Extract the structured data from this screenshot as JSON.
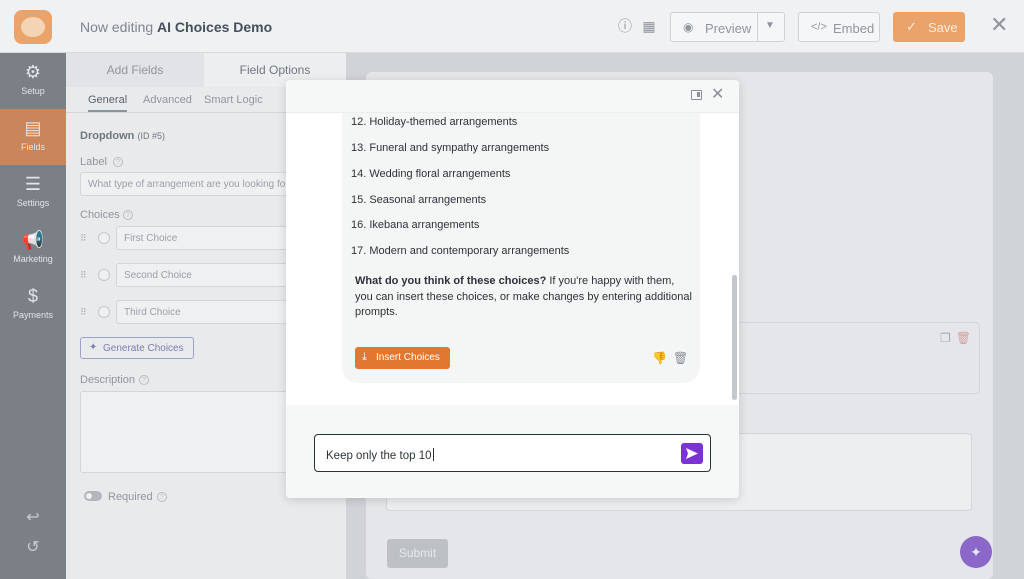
{
  "header": {
    "title_prefix": "Now editing ",
    "title_form": "AI Choices Demo",
    "help_icon": "help-icon",
    "grid_icon": "grid-icon",
    "preview_label": "Preview",
    "embed_label": "Embed",
    "save_label": "Save",
    "brand_color": "#e27730"
  },
  "nav": {
    "items": [
      {
        "label": "Setup",
        "icon": "gear-icon"
      },
      {
        "label": "Fields",
        "icon": "fields-icon"
      },
      {
        "label": "Settings",
        "icon": "sliders-icon"
      },
      {
        "label": "Marketing",
        "icon": "megaphone-icon"
      },
      {
        "label": "Payments",
        "icon": "dollar-icon"
      }
    ],
    "active": "Fields"
  },
  "panel": {
    "tab_add": "Add Fields",
    "tab_options": "Field Options",
    "subtabs": [
      "General",
      "Advanced",
      "Smart Logic"
    ],
    "field_type": "Dropdown",
    "field_id": "(ID #5)",
    "label_title": "Label",
    "label_value": "What type of arrangement are you looking for?",
    "choices_title": "Choices",
    "choices": [
      "First Choice",
      "Second Choice",
      "Third Choice"
    ],
    "generate_label": "Generate Choices",
    "description_title": "Description",
    "required_label": "Required"
  },
  "canvas": {
    "submit_label": "Submit"
  },
  "modal": {
    "choices": [
      "12. Holiday-themed arrangements",
      "13. Funeral and sympathy arrangements",
      "14. Wedding floral arrangements",
      "15. Seasonal arrangements",
      "16. Ikebana arrangements",
      "17. Modern and contemporary arrangements"
    ],
    "response_bold": "What do you think of these choices?",
    "response_rest": " If you're happy with them, you can insert these choices, or make changes by entering additional prompts.",
    "insert_label": "Insert Choices",
    "prompt_value": "Keep only the top 10",
    "accent_color": "#7a34d6"
  }
}
